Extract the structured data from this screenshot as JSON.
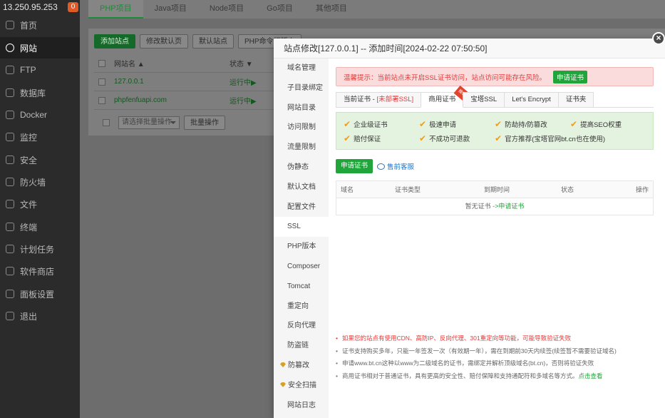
{
  "sidebar": {
    "ip": "13.250.95.253",
    "badge": "0",
    "items": [
      {
        "label": "首页",
        "icon": "home-icon"
      },
      {
        "label": "网站",
        "icon": "globe-icon"
      },
      {
        "label": "FTP",
        "icon": "ftp-icon"
      },
      {
        "label": "数据库",
        "icon": "database-icon"
      },
      {
        "label": "Docker",
        "icon": "docker-icon"
      },
      {
        "label": "监控",
        "icon": "monitor-icon"
      },
      {
        "label": "安全",
        "icon": "shield-icon"
      },
      {
        "label": "防火墙",
        "icon": "firewall-icon"
      },
      {
        "label": "文件",
        "icon": "folder-icon"
      },
      {
        "label": "终端",
        "icon": "terminal-icon"
      },
      {
        "label": "计划任务",
        "icon": "calendar-icon"
      },
      {
        "label": "软件商店",
        "icon": "store-icon"
      },
      {
        "label": "面板设置",
        "icon": "gear-icon"
      },
      {
        "label": "退出",
        "icon": "logout-icon"
      }
    ]
  },
  "main": {
    "tabs": [
      "PHP项目",
      "Java项目",
      "Node项目",
      "Go项目",
      "其他项目"
    ],
    "toolbar": {
      "add_site": "添加站点",
      "edit_default_page": "修改默认页",
      "default_site": "默认站点",
      "php_cli": "PHP命令行版本"
    },
    "table": {
      "headers": {
        "name": "网站名 ▲",
        "status": "状态 ▼"
      },
      "rows": [
        {
          "name": "127.0.0.1",
          "status": "运行中▶"
        },
        {
          "name": "phpfenfuapi.com",
          "status": "运行中▶"
        }
      ]
    },
    "batch_select_placeholder": "请选择批量操作",
    "batch_button": "批量操作"
  },
  "dialog": {
    "title": "站点修改[127.0.0.1] -- 添加时间[2024-02-22 07:50:50]",
    "close_glyph": "×",
    "side_items": [
      "域名管理",
      "子目录绑定",
      "网站目录",
      "访问限制",
      "流量限制",
      "伪静态",
      "默认文档",
      "配置文件",
      "SSL",
      "PHP版本",
      "Composer",
      "Tomcat",
      "重定向",
      "反向代理",
      "防盗链",
      "防篡改",
      "安全扫描",
      "网站日志"
    ],
    "warning_text": "温馨提示：当前站点未开启SSL证书访问，站点访问可能存在风险。",
    "warning_button": "申请证书",
    "cert_tabs": {
      "current_prefix": "当前证书 - ",
      "current_status": "[未部署SSL]",
      "commercial": "商用证书",
      "ribbon": "推荐",
      "baota": "宝塔SSL",
      "letsencrypt": "Let's Encrypt",
      "folder": "证书夹"
    },
    "features": [
      "企业级证书",
      "极速申请",
      "防劫持/防篡改",
      "提高SEO权重",
      "赔付保证",
      "不成功可退款",
      "官方推荐(宝塔官网bt.cn也在使用)"
    ],
    "apply_button": "申请证书",
    "support_link": "售前客服",
    "table_headers": {
      "domain": "域名",
      "type": "证书类型",
      "expire": "到期时间",
      "status": "状态",
      "action": "操作"
    },
    "empty_text": "暂无证书",
    "empty_link": "->申请证书",
    "notes": [
      "如果您的站点有使用CDN、高防IP、反向代理、301重定向等功能，可能导致验证失败",
      "证书支持购买多年，只能一年签发一次（有效期一年），需在到期前30天内续签(续签暂不需要验证域名)",
      "申请www.bt.cn这种以www为二级域名的证书，需绑定并解析顶级域名(bt.cn)，否则将验证失败",
      "商用证书相对于普通证书，具有更高的安全性、赔付保障和支持通配符和多域名等方式。"
    ],
    "notes_link": "点击查看"
  },
  "colors": {
    "accent": "#20a53a",
    "warning": "#e53a3a",
    "check": "#f29b1a",
    "link_blue": "#2076c8"
  }
}
